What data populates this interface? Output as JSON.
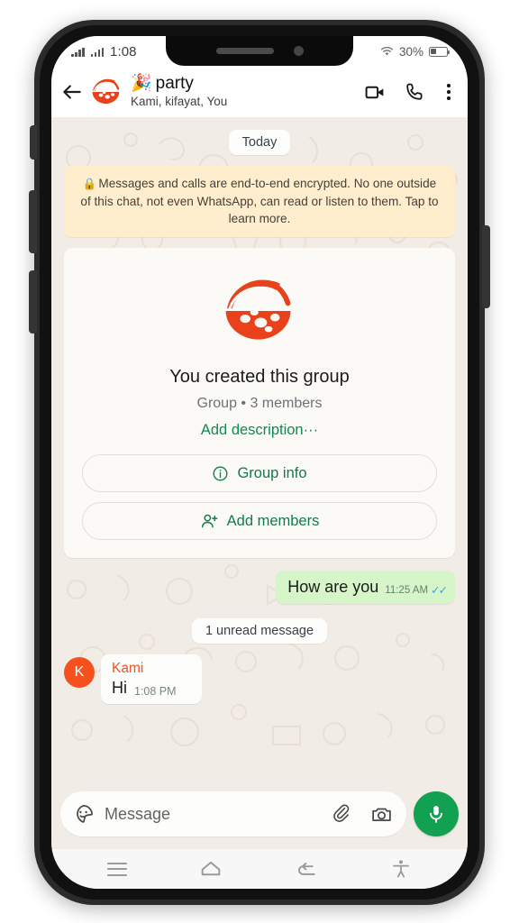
{
  "status_bar": {
    "time": "1:08",
    "battery_percent": "30%",
    "signal_icon": "cellular-signal-icon",
    "wifi_icon": "wifi-icon",
    "battery_icon": "battery-icon"
  },
  "header": {
    "back_icon": "back-arrow-icon",
    "avatar_icon": "group-avatar-pizza-icon",
    "title_emoji": "🎉",
    "title": "party",
    "subtitle": "Kami, kifayat, You",
    "video_call_icon": "video-call-icon",
    "voice_call_icon": "phone-call-icon",
    "overflow_icon": "more-options-icon"
  },
  "chat": {
    "date_divider": "Today",
    "encryption_notice": "Messages and calls are end-to-end encrypted. No one outside of this chat, not even WhatsApp, can read or listen to them. Tap to learn more.",
    "encryption_lock_icon": "lock-icon",
    "group_card": {
      "avatar_icon": "group-avatar-pizza-icon",
      "title": "You created this group",
      "subtitle": "Group • 3 members",
      "description_link": "Add description···",
      "buttons": [
        {
          "label": "Group info",
          "icon": "info-circle-icon"
        },
        {
          "label": "Add members",
          "icon": "add-person-icon"
        }
      ]
    },
    "messages": [
      {
        "direction": "outgoing",
        "text": "How are you",
        "time": "11:25 AM",
        "status_icon": "read-double-check-icon",
        "status_ticks": "✓✓"
      }
    ],
    "unread_divider": "1 unread message",
    "incoming": {
      "avatar_letter": "K",
      "sender": "Kami",
      "text": "Hi",
      "time": "1:08 PM"
    }
  },
  "input_bar": {
    "sticker_icon": "sticker-emoji-icon",
    "placeholder": "Message",
    "attach_icon": "paperclip-attach-icon",
    "camera_icon": "camera-icon",
    "mic_icon": "microphone-icon"
  },
  "nav_bar": {
    "recents_icon": "recent-apps-icon",
    "home_icon": "home-icon",
    "back_icon": "back-nav-icon",
    "accessibility_icon": "accessibility-icon"
  },
  "colors": {
    "accent_green": "#12a150",
    "link_green": "#0f8a52",
    "sender_orange": "#f4511e",
    "chat_bg": "#f1ece5",
    "outgoing_bubble": "#d6f5c9",
    "encryption_bg": "#ffeecd",
    "tick_blue": "#3ba3f5"
  }
}
